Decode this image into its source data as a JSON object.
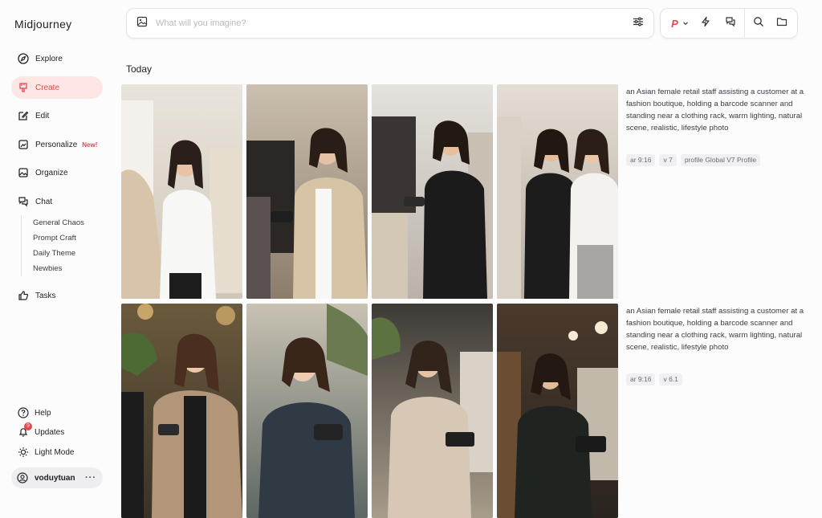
{
  "app": {
    "title": "Midjourney"
  },
  "nav": {
    "explore": "Explore",
    "create": "Create",
    "edit": "Edit",
    "personalize": "Personalize",
    "personalize_badge": "New!",
    "organize": "Organize",
    "chat": "Chat",
    "chat_rooms": [
      "General Chaos",
      "Prompt Craft",
      "Daily Theme",
      "Newbies"
    ],
    "tasks": "Tasks"
  },
  "bottom": {
    "help": "Help",
    "updates": "Updates",
    "updates_count": "9",
    "light_mode": "Light Mode",
    "username": "voduytuan",
    "more": "···"
  },
  "search": {
    "placeholder": "What will you imagine?",
    "value": ""
  },
  "toolbar": {
    "personalize_mark": "P"
  },
  "feed": {
    "section": "Today",
    "jobs": [
      {
        "prompt": "an Asian female retail staff assisting a customer at a fashion boutique, holding a barcode scanner and standing near a clothing rack, warm lighting, natural scene, realistic, lifestyle photo",
        "tags": [
          "ar 9:16",
          "v 7",
          "profile Global V7 Profile"
        ]
      },
      {
        "prompt": "an Asian female retail staff assisting a customer at a fashion boutique, holding a barcode scanner and standing near a clothing rack, warm lighting, natural scene, realistic, lifestyle photo",
        "tags": [
          "ar 9:16",
          "v 6.1"
        ]
      }
    ]
  },
  "colors": {
    "accent": "#e5484d",
    "active_bg": "#fde6e4"
  }
}
